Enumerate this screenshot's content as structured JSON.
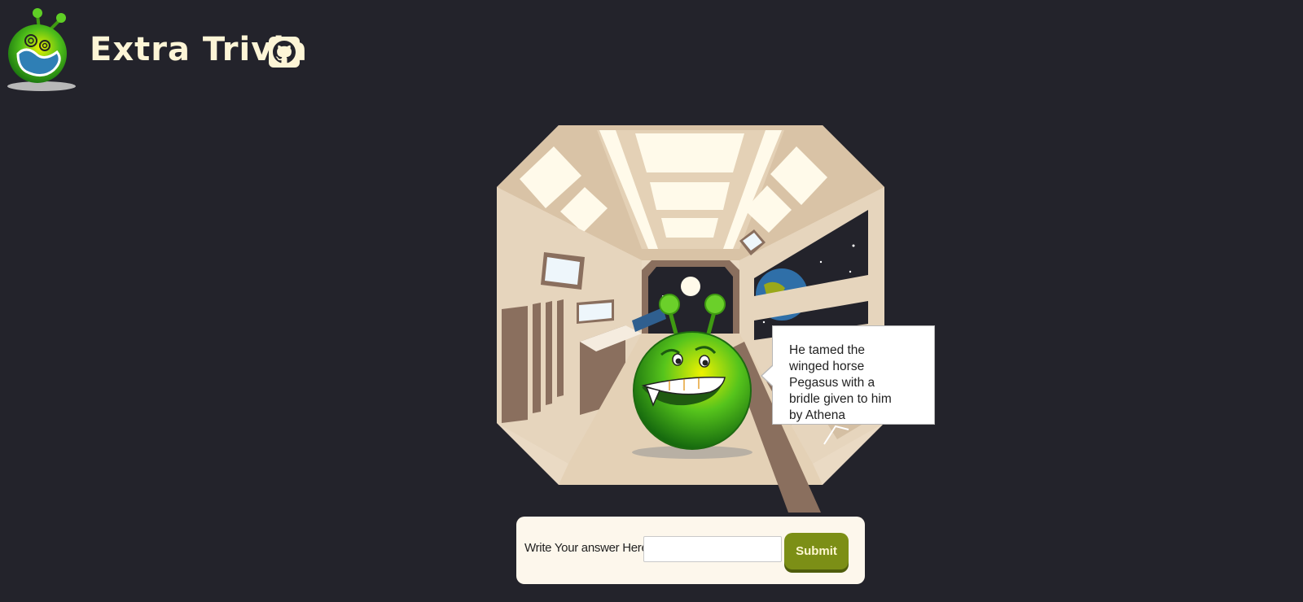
{
  "header": {
    "title": "Extra Trivia",
    "logo_icon": "alien-logo-icon",
    "github_icon": "github-icon"
  },
  "scene": {
    "setting": "spaceship-corridor-illustration",
    "character": "green-alien-icon"
  },
  "speech_bubble": {
    "clue": "He tamed the winged horse Pegasus with a bridle given to him by Athena"
  },
  "answer_form": {
    "label": "Write Your answer Here:",
    "input_value": "",
    "input_placeholder": "",
    "submit_label": "Submit"
  },
  "colors": {
    "background": "#23232b",
    "title": "#fdf5d6",
    "panel": "#fdf7ec",
    "submit": "#7c8f16",
    "alien_green": "#4fbf1a"
  }
}
